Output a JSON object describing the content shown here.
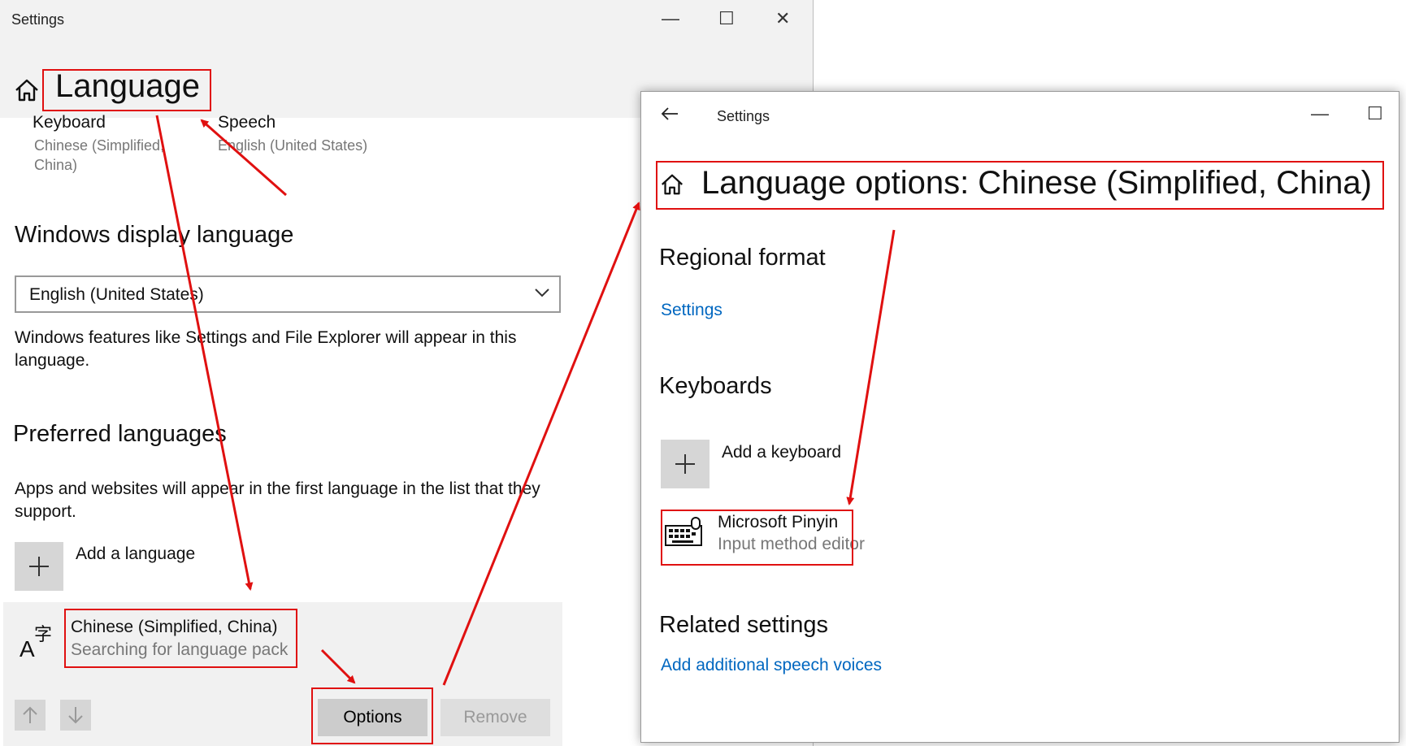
{
  "window1": {
    "title": "Settings",
    "controls": {
      "minimize": "—",
      "maximize": "☐",
      "close": "✕"
    },
    "page_title": "Language",
    "quick_links": [
      {
        "title": "Keyboard",
        "subtitle": "Chinese (Simplified, China)",
        "subtitle_line1": "Chinese (Simplified,",
        "subtitle_line2": "China)"
      },
      {
        "title": "Speech",
        "subtitle": "English (United States)"
      }
    ],
    "display_language": {
      "heading": "Windows display language",
      "selected": "English (United States)",
      "description_line1": "Windows features like Settings and File Explorer will appear in this",
      "description_line2": "language."
    },
    "preferred": {
      "heading": "Preferred languages",
      "description_line1": "Apps and websites will appear in the first language in the list that they",
      "description_line2": "support.",
      "add_label": "Add a language",
      "language": {
        "name": "Chinese (Simplified, China)",
        "status": "Searching for language pack"
      },
      "options_label": "Options",
      "remove_label": "Remove"
    }
  },
  "window2": {
    "title": "Settings",
    "controls": {
      "minimize": "—",
      "maximize": "☐"
    },
    "page_title": "Language options: Chinese (Simplified, China)",
    "regional_format": {
      "heading": "Regional format",
      "link": "Settings"
    },
    "keyboards": {
      "heading": "Keyboards",
      "add_label": "Add a keyboard",
      "item": {
        "name": "Microsoft Pinyin",
        "subtitle": "Input method editor"
      }
    },
    "related": {
      "heading": "Related settings",
      "link": "Add additional speech voices"
    }
  },
  "annotation_color": "#e01010",
  "link_color": "#0067c0"
}
